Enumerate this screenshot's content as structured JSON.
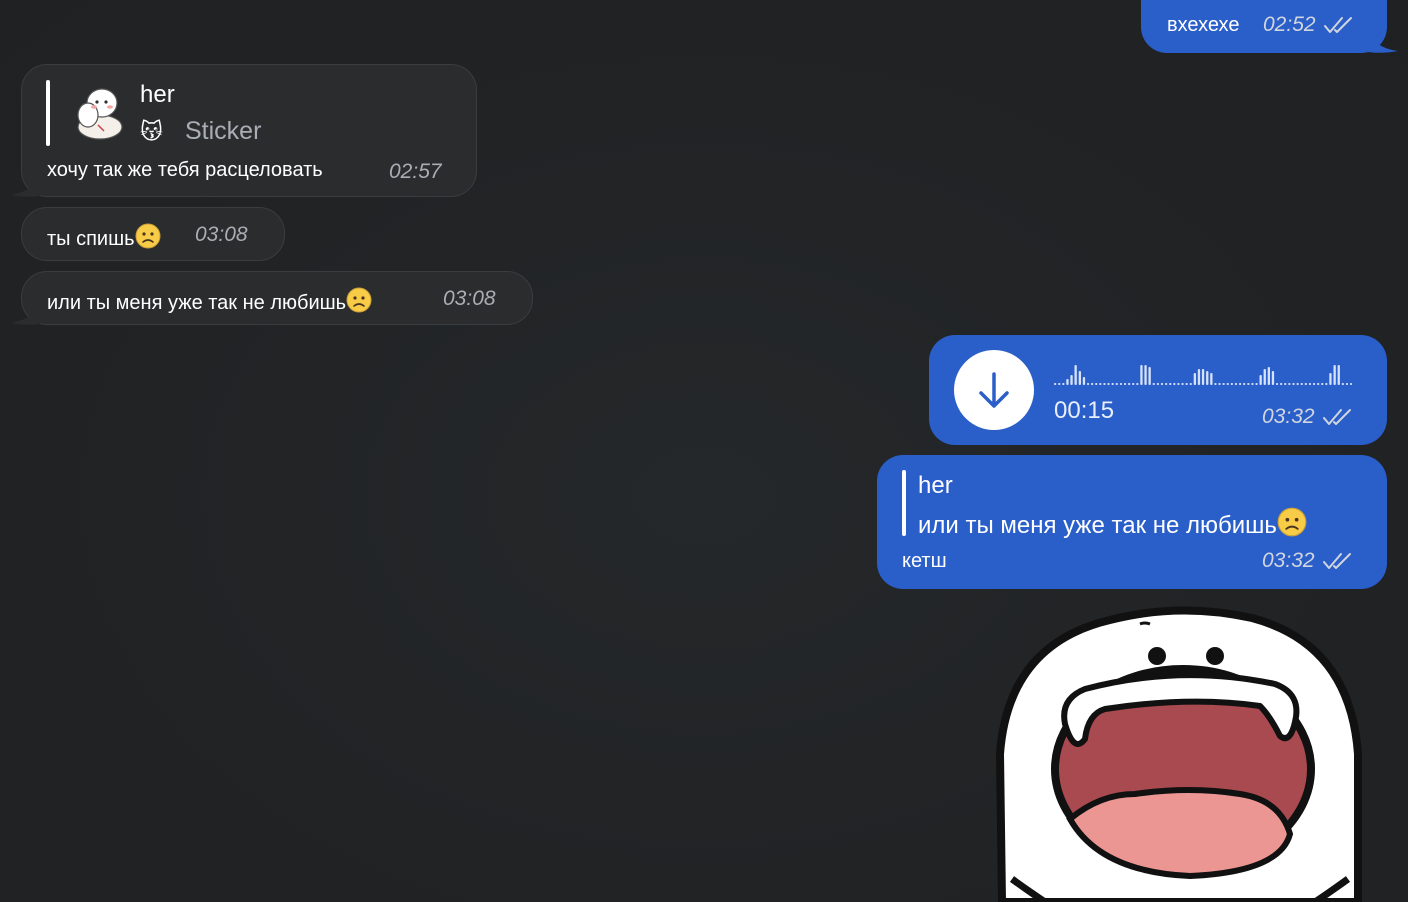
{
  "messages": {
    "m1": {
      "text": "вхехехе",
      "time": "02:52"
    },
    "m2": {
      "reply_author": "her",
      "reply_emoji": "😽",
      "reply_label": "Sticker",
      "text": "хочу так же тебя расцеловать",
      "time": "02:57"
    },
    "m3": {
      "text": "ты спишь",
      "time": "03:08"
    },
    "m4": {
      "text": "или ты меня уже так не любишь",
      "time": "03:08"
    },
    "m5": {
      "duration": "00:15",
      "time": "03:32"
    },
    "m6": {
      "reply_author": "her",
      "reply_text": "или ты меня уже так не любишь",
      "text": "кетш",
      "time": "03:32"
    }
  },
  "colors": {
    "background": "#212325",
    "incoming_bubble": "#2b2c2e",
    "outgoing_bubble": "#2a5ec9",
    "voice_button": "#ffffff",
    "voice_arrow": "#2a5ec9"
  },
  "icons": {
    "read_status": "double-check-icon",
    "download": "arrow-down-icon",
    "emoji": "frowning-face-emoji"
  }
}
